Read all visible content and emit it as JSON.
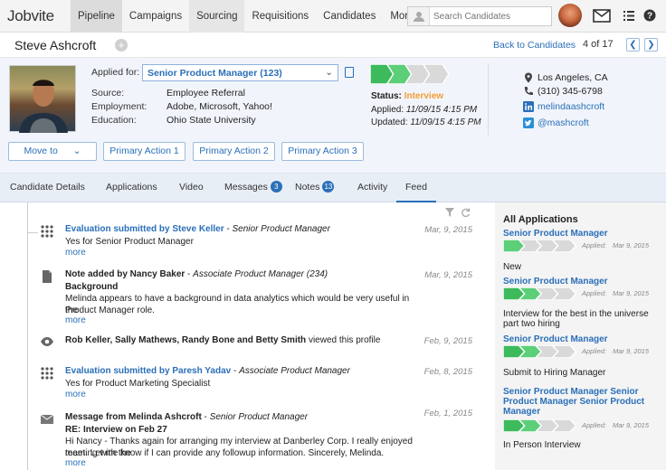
{
  "app": {
    "logo": "Jobvite"
  },
  "nav": [
    "Pipeline",
    "Campaigns",
    "Sourcing",
    "Requisitions",
    "Candidates",
    "More"
  ],
  "search": {
    "placeholder": "Search Candidates"
  },
  "candidate": {
    "name": "Steve Ashcroft"
  },
  "pager": {
    "back_label": "Back to Candidates",
    "count": "4 of 17"
  },
  "profile": {
    "applied_for_label": "Applied for:",
    "applied_for_value": "Senior Product Manager (123)",
    "fields": [
      {
        "label": "Source:",
        "value": "Employee Referral"
      },
      {
        "label": "Employment:",
        "value": "Adobe, Microsoft, Yahoo!"
      },
      {
        "label": "Education:",
        "value": "Ohio State University"
      }
    ],
    "status_label": "Status:",
    "status_value": "Interview",
    "applied_line_label": "Applied:",
    "applied_line_value": "11/09/15 4:15 PM",
    "updated_line_label": "Updated:",
    "updated_line_value": "11/09/15 4:15 PM",
    "location": "Los Angeles, CA",
    "phone": "(310) 345-6798",
    "linkedin": "melindaashcroft",
    "twitter": "@mashcroft",
    "progress_steps_done": 2,
    "progress_steps_total": 4
  },
  "actions": {
    "move_to": "Move to",
    "primary1": "Primary Action 1",
    "primary2": "Primary Action 2",
    "primary3": "Primary Action 3"
  },
  "tabs": [
    {
      "label": "Candidate Details"
    },
    {
      "label": "Applications"
    },
    {
      "label": "Video"
    },
    {
      "label": "Messages",
      "badge": "3"
    },
    {
      "label": "Notes",
      "badge": "13"
    },
    {
      "label": "Activity"
    },
    {
      "label": "Feed"
    }
  ],
  "feed": [
    {
      "icon": "grid-icon",
      "title_link": "Evaluation submitted by Steve Keller",
      "title_suffix": "Senior Product Manager",
      "lines": [
        "Yes for Senior Product Manager"
      ],
      "more": "more",
      "date": "Mar, 9, 2015"
    },
    {
      "icon": "document-icon",
      "title_bold": "Note added by Nancy Baker",
      "title_suffix": "Associate Product Manager (234)",
      "subhead": "Background",
      "lines": [
        "Melinda appears to have a background in data analytics which would be very useful in the",
        "Product Manager role."
      ],
      "more": "more",
      "date": "Mar, 9, 2015"
    },
    {
      "icon": "eye-icon",
      "title_bold": "Rob Keller, Sally Mathews, Randy Bone and Betty Smith",
      "title_plain": "viewed this profile",
      "date": "Feb, 9, 2015"
    },
    {
      "icon": "grid-icon",
      "title_link": "Evaluation submitted by Paresh Yadav",
      "title_suffix": "Associate Product Manager",
      "lines": [
        "Yes for Product Marketing Specialist"
      ],
      "more": "more",
      "date": "Feb, 8, 2015"
    },
    {
      "icon": "envelope-icon",
      "title_bold": "Message from Melinda Ashcroft",
      "title_suffix": "Senior Product Manager",
      "subhead": "RE: Interview on Feb 27",
      "lines": [
        "Hi Nancy - Thanks again for arranging my interview at Danberley Corp. I really enjoyed meeting with the",
        "team. Let me know if I can provide any followup information. Sincerely, Melinda."
      ],
      "more": "more",
      "date": "Feb, 1, 2015"
    }
  ],
  "sidebar": {
    "title": "All Applications",
    "applications": [
      {
        "job": "Senior Product Manager",
        "applied_label": "Applied:",
        "date": "Mar 9, 2015",
        "status": "New",
        "steps_done": 1
      },
      {
        "job": "Senior Product Manager",
        "applied_label": "Applied:",
        "date": "Mar 9, 2015",
        "status": "Interview for the best in the universe part two hiring",
        "steps_done": 2
      },
      {
        "job": "Senior Product Manager",
        "applied_label": "Applied:",
        "date": "Mar 9, 2015",
        "status": "Submit to Hiring Manager",
        "steps_done": 2
      },
      {
        "job": "Senior Product Manager Senior Product Manager Senior Product Manager",
        "applied_label": "Applied:",
        "date": "Mar 9, 2015",
        "status": "In Person Interview",
        "steps_done": 2
      }
    ]
  },
  "colors": {
    "accent": "#2a6fb8",
    "progress_green": "#3dba5c",
    "status_orange": "#f39c34"
  }
}
